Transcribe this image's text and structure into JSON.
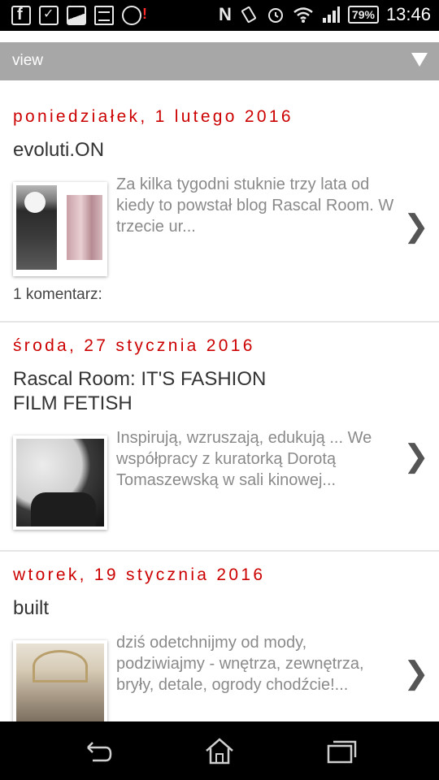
{
  "status_bar": {
    "time": "13:46",
    "battery": "79%",
    "icons_left": [
      "facebook-icon",
      "checkbox-icon",
      "image-icon",
      "card-icon",
      "disc-alert-icon"
    ],
    "icons_right": [
      "nfc-icon",
      "vibrate-icon",
      "alarm-icon",
      "wifi-icon",
      "signal-icon",
      "battery-icon"
    ]
  },
  "viewbar": {
    "label": "view"
  },
  "posts": [
    {
      "date": "poniedziałek, 1 lutego 2016",
      "title": "evoluti.ON",
      "snippet": "Za kilka tygodni stuknie trzy lata od kiedy to powstał blog Rascal Room. W trzecie ur...",
      "comments": "1 komentarz:"
    },
    {
      "date": "środa, 27 stycznia 2016",
      "title": "Rascal Room: IT'S FASHION FILM FETISH",
      "snippet": "Inspirują, wzruszają, edukują ... We współpracy z kuratorką Dorotą Tomaszewską w sali kinowej..."
    },
    {
      "date": "wtorek, 19 stycznia 2016",
      "title": "built",
      "snippet": "dziś odetchnijmy od mody, podziwiajmy - wnętrza, zewnętrza, bryły, detale, ogrody chodźcie!..."
    }
  ],
  "navbar": {
    "buttons": [
      "back",
      "home",
      "recent-apps"
    ]
  },
  "colors": {
    "date_red": "#cc0000",
    "viewbar_gray": "#a7a7a7"
  }
}
